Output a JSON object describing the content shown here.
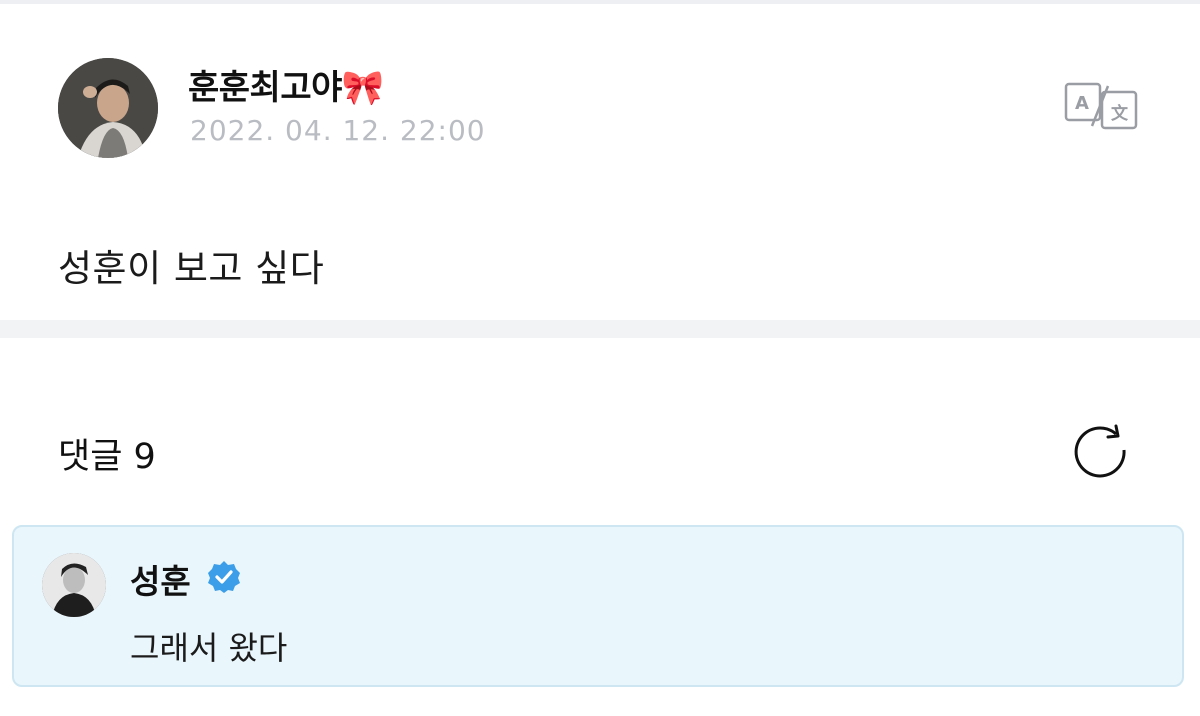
{
  "post": {
    "author": "훈훈최고야🎀",
    "date": "2022. 04. 12. 22:00",
    "body": "성훈이 보고 싶다"
  },
  "icons": {
    "translate": "translate-icon",
    "refresh": "refresh-icon",
    "verified": "verified-badge-icon"
  },
  "comments": {
    "label": "댓글 9",
    "items": [
      {
        "author": "성훈",
        "verified": true,
        "text": "그래서 왔다"
      }
    ]
  },
  "colors": {
    "accent_blue": "#3c9ee8",
    "comment_bg": "#e9f6fc",
    "comment_border": "#cde6f2",
    "muted_text": "#b9bcc2"
  }
}
